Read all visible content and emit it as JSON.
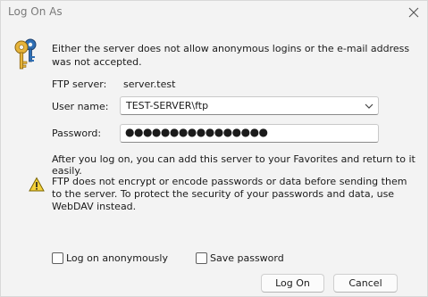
{
  "window": {
    "title": "Log On As",
    "close_icon": "close-icon"
  },
  "message": "Either the server does not allow anonymous logins or the e-mail address was not accepted.",
  "server": {
    "label": "FTP server:",
    "value": "server.test"
  },
  "user": {
    "label": "User name:",
    "value": "TEST-SERVER\\ftp"
  },
  "password": {
    "label": "Password:",
    "value": "●●●●●●●●●●●●●●●●"
  },
  "info_text": "After you log on, you can add this server to your Favorites and return to it easily.",
  "warning_text": "FTP does not encrypt or encode passwords or data before sending them to the server.  To protect the security of your passwords and data, use WebDAV instead.",
  "options": {
    "anonymous_label": "Log on anonymously",
    "anonymous_checked": false,
    "save_password_label": "Save password",
    "save_password_checked": false
  },
  "buttons": {
    "logon_label": "Log On",
    "cancel_label": "Cancel"
  }
}
